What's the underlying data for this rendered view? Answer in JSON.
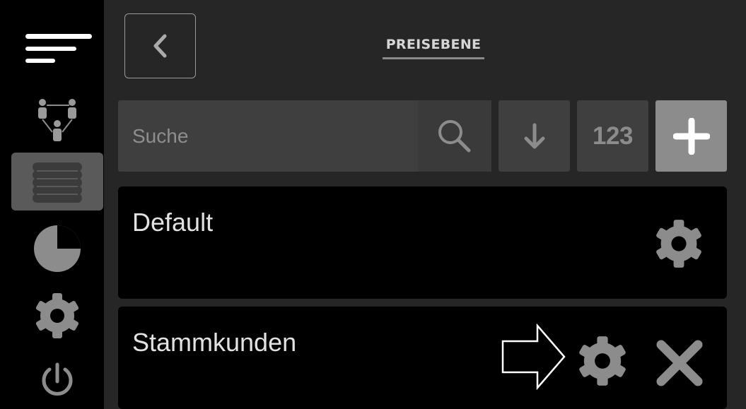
{
  "header": {
    "title": "PREISEBENE",
    "back_icon": "chevron-left-icon"
  },
  "sidebar": {
    "items": [
      {
        "icon": "hamburger-menu-icon",
        "active": false
      },
      {
        "icon": "users-network-icon",
        "active": false
      },
      {
        "icon": "database-stack-icon",
        "active": true
      },
      {
        "icon": "pie-chart-icon",
        "active": false
      },
      {
        "icon": "gear-icon",
        "active": false
      },
      {
        "icon": "power-icon",
        "active": false
      }
    ]
  },
  "toolbar": {
    "search_placeholder": "Suche",
    "search_value": "",
    "sort_icon": "arrow-down-icon",
    "numeric_label": "123",
    "add_icon": "plus-icon"
  },
  "price_levels": [
    {
      "name": "Default",
      "actions": [
        "gear-icon"
      ]
    },
    {
      "name": "Stammkunden",
      "actions": [
        "gear-icon",
        "close-icon"
      ]
    }
  ],
  "colors": {
    "background": "#000000",
    "panel": "#262626",
    "input": "#3f3f3f",
    "active_sidebar": "#5a5a5a",
    "add_button": "#8c8c8c",
    "text": "#e2e2e2"
  }
}
